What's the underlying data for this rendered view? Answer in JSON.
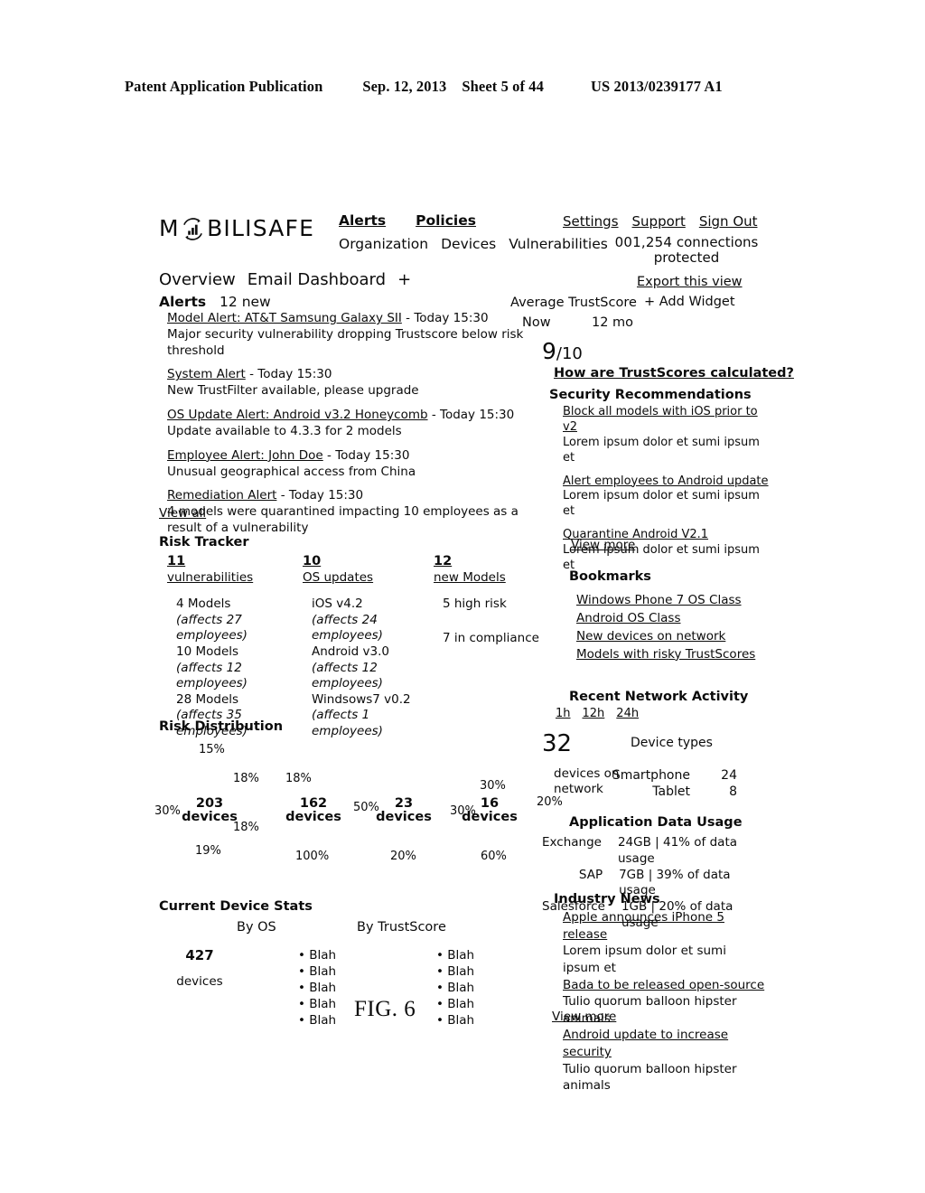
{
  "patent_header": {
    "title": "Patent Application Publication",
    "date": "Sep. 12, 2013",
    "sheet": "Sheet 5 of 44",
    "number": "US 2013/0239177 A1"
  },
  "figure_label": "FIG. 6",
  "brand": {
    "name_before": "M",
    "icon": "bar-chart-swirl-icon",
    "name_after": "BILISAFE"
  },
  "nav": {
    "primary": [
      "Alerts",
      "Policies"
    ],
    "secondary": [
      "Organization",
      "Devices",
      "Vulnerabilities"
    ],
    "account": [
      "Settings",
      "Support",
      "Sign Out"
    ],
    "connections_count": "001,254",
    "connections_label": "connections",
    "connections_label2": "protected"
  },
  "view_tabs": [
    "Overview",
    "Email Dashboard",
    "+"
  ],
  "actions": {
    "export": "Export this view",
    "add_widget": "+ Add Widget"
  },
  "alerts": {
    "title": "Alerts",
    "count": "12 new",
    "view_all": "View all",
    "items": [
      {
        "title": "Model Alert: AT&T Samsung Galaxy SII",
        "time": " - Today 15:30",
        "desc": "Major security vulnerability dropping Trustscore below risk threshold"
      },
      {
        "title": "System Alert",
        "time": " - Today 15:30",
        "desc": "New TrustFilter available, please upgrade"
      },
      {
        "title": "OS Update Alert: Android v3.2 Honeycomb",
        "time": " - Today 15:30",
        "desc": "Update available to 4.3.3 for 2 models"
      },
      {
        "title": "Employee Alert: John Doe",
        "time": " - Today 15:30",
        "desc": "Unusual geographical access from China"
      },
      {
        "title": "Remediation Alert",
        "time": " - Today 15:30",
        "desc": "4 models were quarantined impacting 10 employees as a result of a vulnerability"
      }
    ]
  },
  "trustscore": {
    "label": "Average TrustScore",
    "range_now": "Now",
    "range_12mo": "12 mo",
    "score": "9",
    "score_denom": "/10",
    "how_link": "How are TrustScores calculated?"
  },
  "security_recommendations": {
    "title": "Security Recommendations",
    "view_more": "View more",
    "items": [
      {
        "title": "Block all models with iOS prior to v2",
        "sub": "Lorem ipsum dolor et sumi ipsum et"
      },
      {
        "title": "Alert employees to Android update",
        "sub": "Lorem ipsum dolor et sumi ipsum et"
      },
      {
        "title": "Quarantine Android V2.1",
        "sub": "Lorem ipsum dolor et sumi ipsum et"
      }
    ]
  },
  "risk_tracker": {
    "title": "Risk Tracker",
    "columns": [
      {
        "number": "11",
        "label": "vulnerabilities",
        "lines": [
          "4 Models",
          "(affects 27 employees)",
          "10 Models",
          "(affects 12 employees)",
          "28 Models",
          "(affects 35 employees)"
        ]
      },
      {
        "number": "10",
        "label": "OS updates",
        "lines": [
          "iOS v4.2",
          "(affects 24 employees)",
          "Android v3.0",
          "(affects 12 employees)",
          "Windsows7 v0.2",
          "(affects 1 employees)"
        ]
      },
      {
        "number": "12",
        "label": "new Models",
        "lines": [
          "5 high risk",
          "7 in compliance"
        ]
      }
    ]
  },
  "bookmarks": {
    "title": "Bookmarks",
    "items": [
      "Windows Phone 7 OS Class",
      "Android OS Class",
      "New devices on network",
      "Models with risky TrustScores"
    ]
  },
  "recent_network_activity": {
    "title": "Recent Network Activity",
    "ranges": [
      "1h",
      "12h",
      "24h"
    ],
    "devices_number": "32",
    "devices_label1": "devices on",
    "devices_label2": "network",
    "device_types_title": "Device types",
    "device_types": [
      {
        "name": "Smartphone",
        "count": "24"
      },
      {
        "name": "Tablet",
        "count": "8"
      }
    ]
  },
  "application_data_usage": {
    "title": "Application Data Usage",
    "rows": [
      {
        "app": "Exchange",
        "value": "24GB | 41% of data usage"
      },
      {
        "app": "SAP",
        "value": "7GB | 39% of data usage"
      },
      {
        "app": "Salesforce",
        "value": "1GB | 20% of data usage"
      }
    ]
  },
  "industry_news": {
    "title": "Industry News",
    "view_more": "View more",
    "items": [
      {
        "title": "Apple announces iPhone 5 release",
        "sub": "Lorem ipsum dolor et sumi ipsum et"
      },
      {
        "title": "Bada to be released open-source",
        "sub": "Tulio quorum balloon hipster animals"
      },
      {
        "title": "Android update to increase security",
        "sub": "Tulio quorum balloon hipster animals"
      }
    ]
  },
  "current_device_stats": {
    "title": "Current Device Stats",
    "total": "427",
    "total_label": "devices",
    "by_os_label": "By OS",
    "by_trustscore_label": "By TrustScore",
    "by_os_items": [
      "Blah",
      "Blah",
      "Blah",
      "Blah",
      "Blah"
    ],
    "by_trustscore_items": [
      "Blah",
      "Blah",
      "Blah",
      "Blah",
      "Blah"
    ]
  },
  "chart_data": {
    "type": "pie",
    "title": "Risk Distribution",
    "charts": [
      {
        "center_number": "203",
        "center_label": "devices",
        "labels": [
          "15%",
          "18%",
          "18%",
          "19%",
          "30%"
        ],
        "values": [
          15,
          18,
          18,
          19,
          30
        ]
      },
      {
        "center_number": "162",
        "center_label": "devices",
        "labels": [
          "18%",
          "50%",
          "100%"
        ],
        "values": [
          18,
          50,
          100
        ]
      },
      {
        "center_number": "23",
        "center_label": "devices",
        "labels": [
          "30%",
          "20%"
        ],
        "values": [
          30,
          20
        ]
      },
      {
        "center_number": "16",
        "center_label": "devices",
        "labels": [
          "30%",
          "20%",
          "60%"
        ],
        "values": [
          30,
          20,
          60
        ]
      }
    ]
  }
}
